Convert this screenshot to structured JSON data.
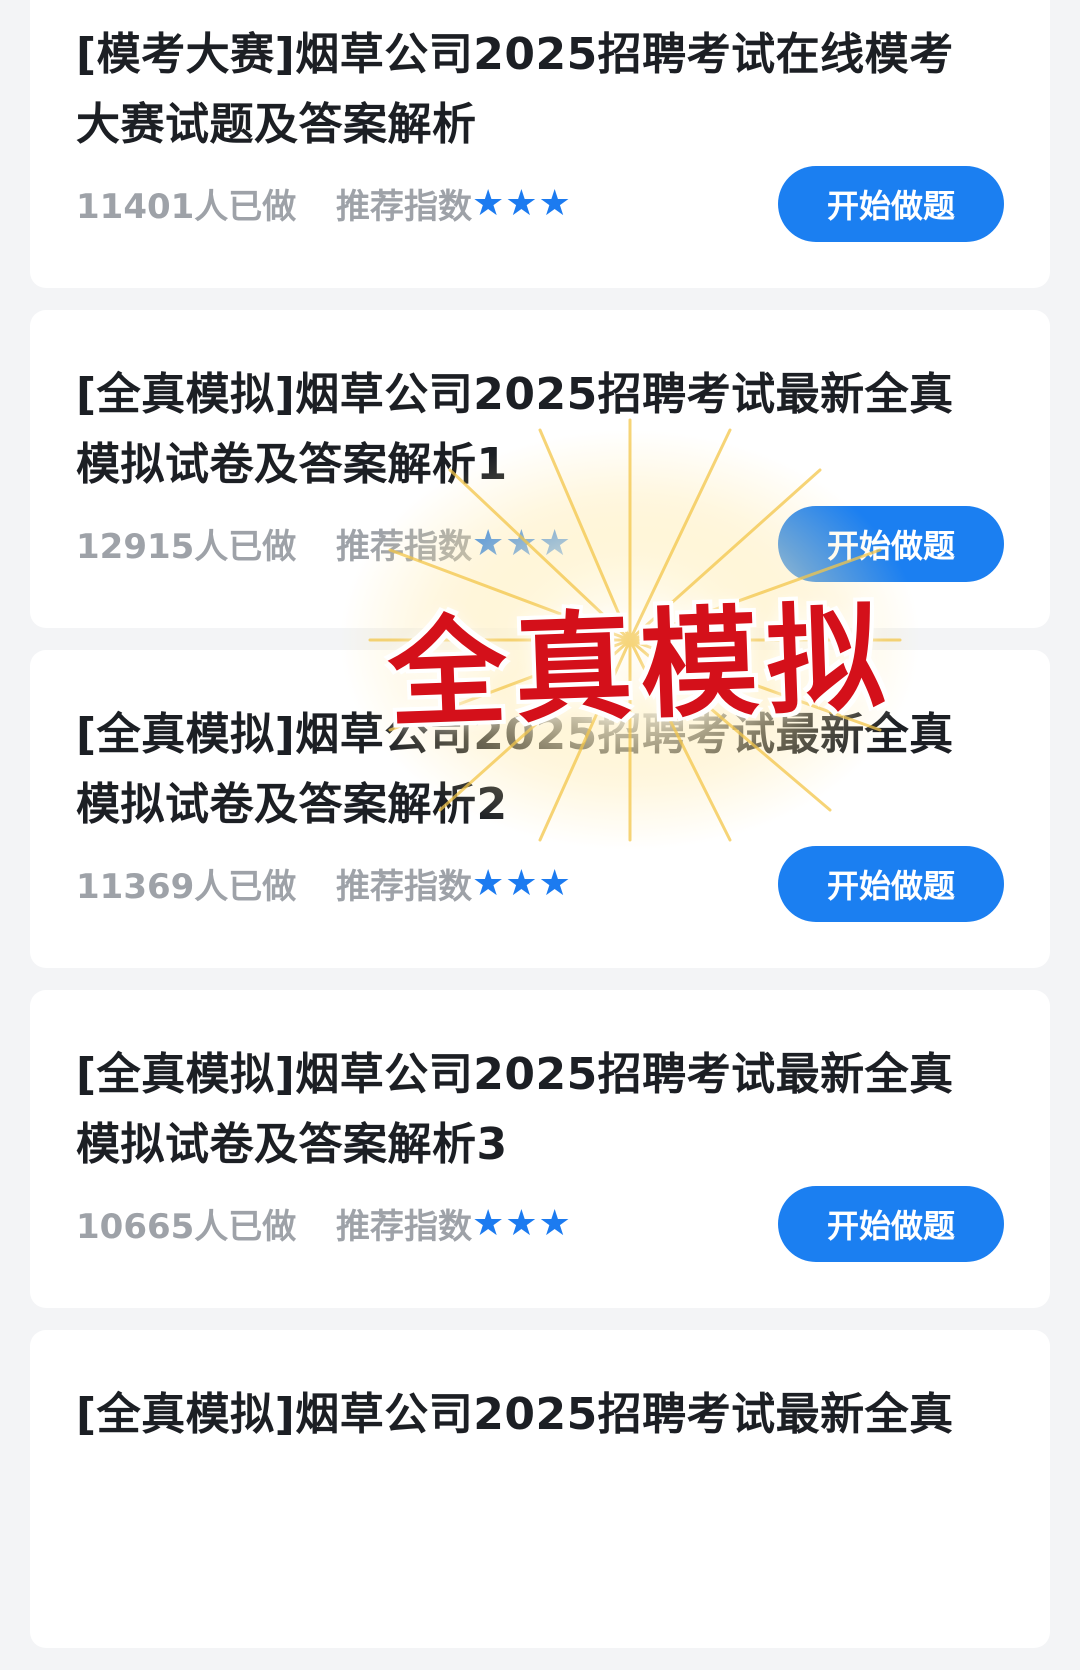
{
  "colors": {
    "accent": "#1b7ff1",
    "star": "#1c7bf0",
    "stamp": "#d4101a",
    "muted": "#9ea2a8"
  },
  "cards": [
    {
      "title_line1": "[模考大赛]烟草公司2025招聘考试在线模考",
      "title_line2": "大赛试题及答案解析",
      "done_count": "11401人已做",
      "rec_label": "推荐指数",
      "stars": "★★★",
      "button_label": "开始做题"
    },
    {
      "title_line1": "[全真模拟]烟草公司2025招聘考试最新全真",
      "title_line2": "模拟试卷及答案解析1",
      "done_count": "12915人已做",
      "rec_label": "推荐指数",
      "stars": "★★★",
      "button_label": "开始做题"
    },
    {
      "title_line1": "[全真模拟]烟草公司2025招聘考试最新全真",
      "title_line2": "模拟试卷及答案解析2",
      "done_count": "11369人已做",
      "rec_label": "推荐指数",
      "stars": "★★★",
      "button_label": "开始做题"
    },
    {
      "title_line1": "[全真模拟]烟草公司2025招聘考试最新全真",
      "title_line2": "模拟试卷及答案解析3",
      "done_count": "10665人已做",
      "rec_label": "推荐指数",
      "stars": "★★★",
      "button_label": "开始做题"
    },
    {
      "title_line1": "[全真模拟]烟草公司2025招聘考试最新全真",
      "title_line2": "",
      "done_count": "",
      "rec_label": "",
      "stars": "",
      "button_label": ""
    }
  ],
  "overlay": {
    "stamp_text": "全真模拟"
  }
}
